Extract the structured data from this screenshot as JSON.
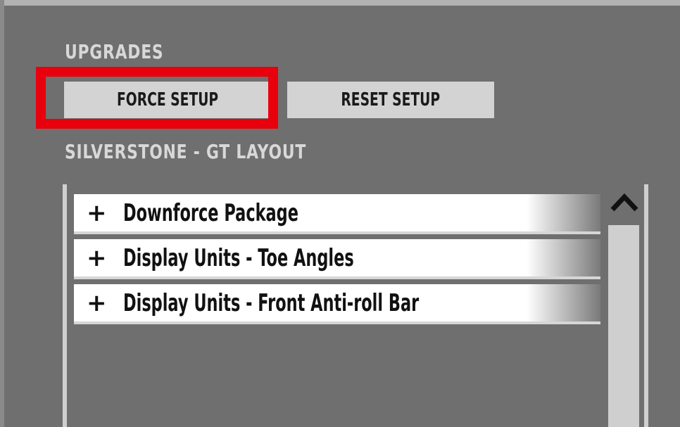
{
  "upgrades": {
    "label": "UPGRADES",
    "force_setup_label": "FORCE SETUP",
    "reset_setup_label": "RESET SETUP"
  },
  "track": {
    "label": "SILVERSTONE - GT LAYOUT"
  },
  "list": {
    "items": [
      {
        "icon": "plus-icon",
        "label": "Downforce Package"
      },
      {
        "icon": "plus-icon",
        "label": "Display Units - Toe Angles"
      },
      {
        "icon": "plus-icon",
        "label": "Display Units - Front Anti-roll Bar"
      }
    ]
  },
  "colors": {
    "panel_bg": "#6f6f6f",
    "button_bg": "#d3d3d3",
    "highlight": "#e8000d",
    "list_item_bg": "#ffffff"
  }
}
